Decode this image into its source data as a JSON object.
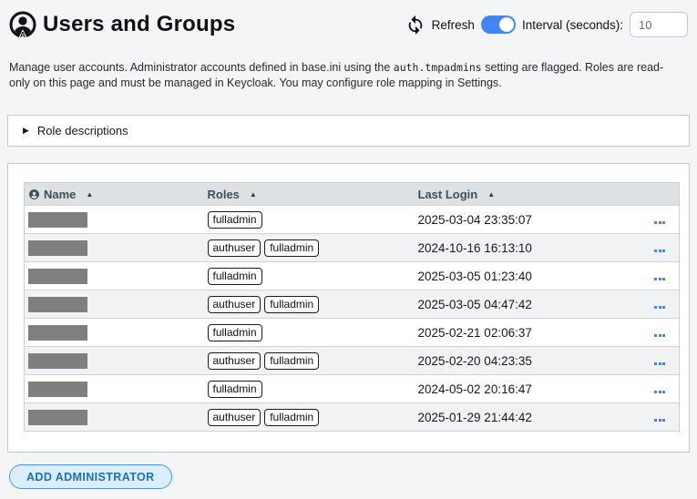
{
  "header": {
    "title": "Users and Groups",
    "refresh": {
      "label": "Refresh",
      "toggle_on": true
    },
    "interval": {
      "label": "Interval (seconds):",
      "value": "10"
    }
  },
  "intro": {
    "text_before_code": "Manage user accounts. Administrator accounts defined in base.ini using the ",
    "code": "auth.tmpadmins",
    "text_after_code": " setting are flagged. Roles are read-only on this page and must be managed in Keycloak. You may configure role mapping in Settings."
  },
  "role_descriptions": {
    "label": "Role descriptions",
    "collapsed_arrow": "▶",
    "expanded": false
  },
  "users_table": {
    "columns": [
      {
        "label": "Name",
        "icon": "account-circle-icon",
        "sort_arrow": "▲"
      },
      {
        "label": "Roles",
        "sort_arrow": "▲"
      },
      {
        "label": "Last Login",
        "sort_arrow": "▲"
      }
    ],
    "rows": [
      {
        "name_redacted": true,
        "roles": [
          "fulladmin"
        ],
        "last_login": "2025-03-04 23:35:07"
      },
      {
        "name_redacted": true,
        "roles": [
          "authuser",
          "fulladmin"
        ],
        "last_login": "2024-10-16 16:13:10"
      },
      {
        "name_redacted": true,
        "roles": [
          "fulladmin"
        ],
        "last_login": "2025-03-05 01:23:40"
      },
      {
        "name_redacted": true,
        "roles": [
          "authuser",
          "fulladmin"
        ],
        "last_login": "2025-03-05 04:47:42"
      },
      {
        "name_redacted": true,
        "roles": [
          "fulladmin"
        ],
        "last_login": "2025-02-21 02:06:37"
      },
      {
        "name_redacted": true,
        "roles": [
          "authuser",
          "fulladmin"
        ],
        "last_login": "2025-02-20 04:23:35"
      },
      {
        "name_redacted": true,
        "roles": [
          "fulladmin"
        ],
        "last_login": "2024-05-02 20:16:47"
      },
      {
        "name_redacted": true,
        "roles": [
          "authuser",
          "fulladmin"
        ],
        "last_login": "2025-01-29 21:44:42"
      }
    ]
  },
  "actions": {
    "add_admin_label": "ADD ADMINISTRATOR"
  },
  "colors": {
    "accent_blue": "#4285f4",
    "page_bg": "#f3f5f6",
    "table_header_bg": "#dde1e4",
    "row_alt_bg": "#f1f2f3",
    "row_border": "#ccd3d6",
    "redaction_gray": "#7f7f7f",
    "button_bg": "#daeefc",
    "button_border": "#4f93e3",
    "button_text": "#1a73b7"
  }
}
